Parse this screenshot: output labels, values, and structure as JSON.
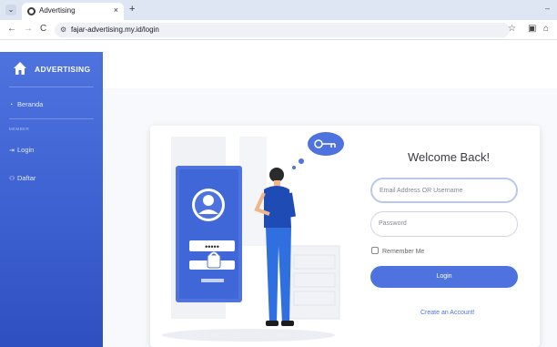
{
  "browser": {
    "tab_title": "Advertising",
    "tab_close": "×",
    "new_tab": "+",
    "minimize": "–",
    "url": "fajar-advertising.my.id/login",
    "back": "←",
    "forward": "→",
    "reload": "C"
  },
  "sidebar": {
    "brand": "ADVERTISING",
    "items": [
      {
        "label": "Beranda",
        "icon": "dashboard-icon"
      },
      {
        "label": "Login",
        "icon": "login-icon"
      },
      {
        "label": "Daftar",
        "icon": "register-icon"
      }
    ],
    "heading": "MEMBER"
  },
  "login": {
    "welcome": "Welcome Back!",
    "email_placeholder": "Email Address OR Username",
    "password_placeholder": "Password",
    "remember": "Remember Me",
    "button": "Login",
    "create_account": "Create an Account!"
  },
  "illustration": {
    "pin": "•••••"
  },
  "colors": {
    "primary": "#4e73df",
    "sidebar_dark": "#2e4fbf",
    "figure_shirt": "#1f4bb5",
    "figure_pants": "#2f6fe0"
  }
}
